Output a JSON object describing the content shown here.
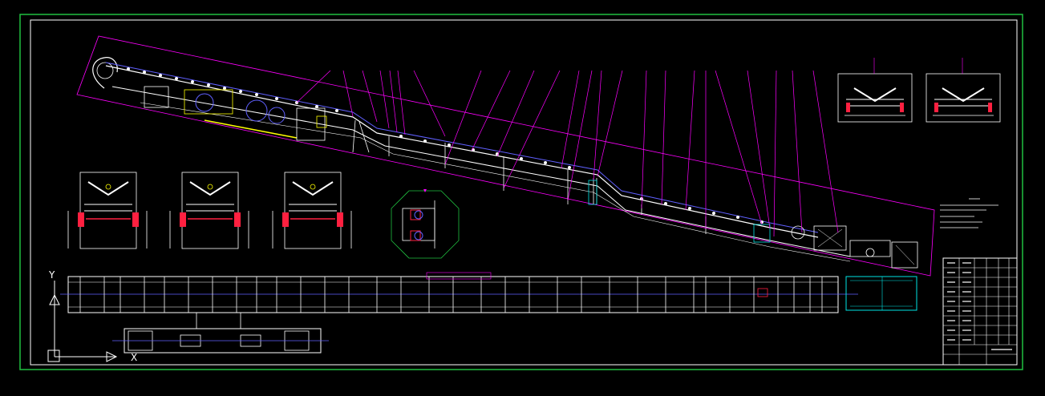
{
  "drawing": {
    "axis_y_label": "Y",
    "axis_x_label": "X",
    "colors": {
      "background": "#000000",
      "frame": "#20c040",
      "border": "#ffffff",
      "leader": "#ff00ff",
      "structure": "#ffffff",
      "belt": "#6060ff",
      "highlight": "#ffff00",
      "accent": "#ff2040",
      "drive": "#00e5e5"
    },
    "section_views_top": [
      "section-view-a",
      "section-view-b"
    ],
    "section_views_left": [
      "section-view-c",
      "section-view-d",
      "section-view-e"
    ],
    "title_block": {
      "rows": 11,
      "columns": 6
    }
  }
}
